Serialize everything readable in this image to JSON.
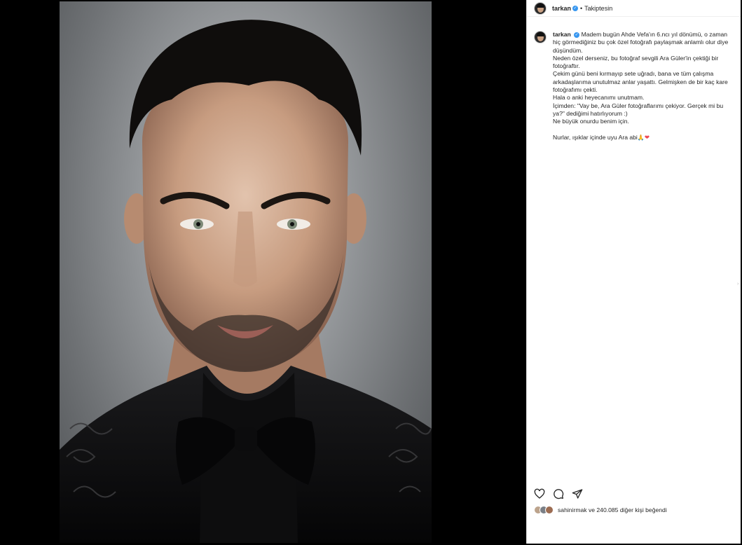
{
  "post": {
    "username": "tarkan",
    "follow_status": "Takiptesin",
    "separator": "•"
  },
  "caption": {
    "username": "tarkan",
    "lines": [
      "Madem bugün Ahde Vefa'ın 6.ncı yıl dönümü, o zaman hiç görmediğiniz bu çok özel fotoğrafı paylaşmak anlamlı olur diye düşündüm.",
      "Neden özel derseniz, bu fotoğraf sevgili Ara Güler'in çektiği bir fotoğraftır.",
      "Çekim günü beni kırmayıp sete uğradı, bana ve tüm çalışma arkadaşlarıma unutulmaz anlar yaşattı. Gelmişken de bir kaç kare fotoğrafımı çekti.",
      "Hala o anki heyecanımı unutmam.",
      "İçimden: \"Vay be, Ara Güler fotoğraflarımı çekiyor. Gerçek mi bu ya?\" dediğimi hatırlıyorum :)",
      "Ne büyük onurdu benim için."
    ],
    "closing": "Nurlar, ışıklar içinde uyu Ara abi",
    "closing_emoji_pray": "🙏",
    "closing_emoji_heart": "❤"
  },
  "likes": {
    "text": "sahinirmak ve 240.085 diğer kişi beğendi"
  },
  "icons": {
    "like": "heart-icon",
    "comment": "comment-icon",
    "share": "share-icon",
    "verified": "verified-badge-icon"
  },
  "colors": {
    "verified_blue": "#3897f0",
    "heart_red": "#ed4956",
    "panel_bg": "#ffffff",
    "stage_bg": "#000000"
  }
}
